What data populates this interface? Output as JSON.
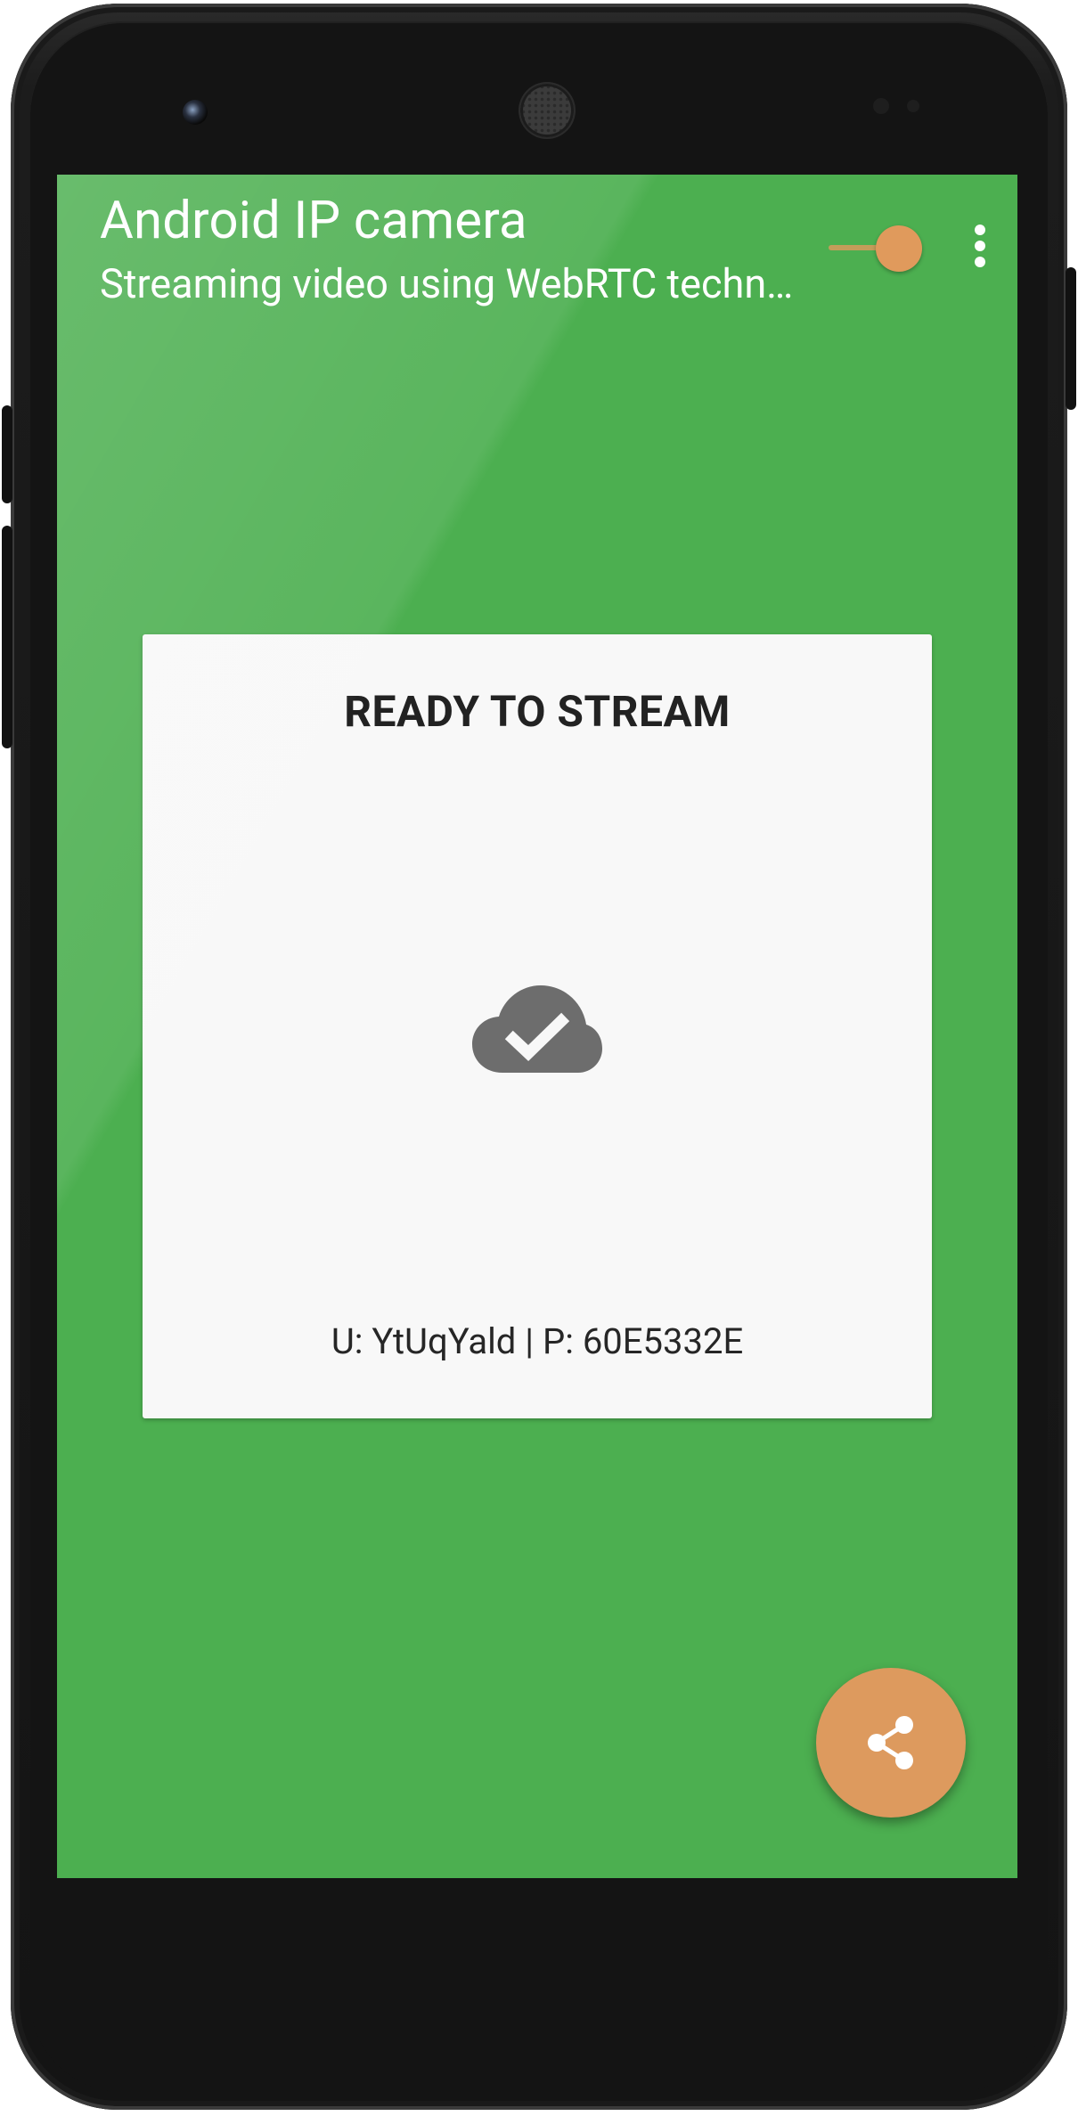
{
  "toolbar": {
    "title": "Android IP camera",
    "subtitle": "Streaming video using WebRTC technology",
    "stream_toggle": {
      "state": "on",
      "color": "#e09a5c"
    },
    "overflow_icon": "more-vert-icon"
  },
  "status_card": {
    "title": "READY TO STREAM",
    "icon": "cloud-done-icon",
    "credentials": "U: YtUqYald | P: 60E5332E"
  },
  "fab": {
    "icon": "share-icon",
    "color": "#dd9a5e"
  },
  "theme": {
    "primary": "#4caf50",
    "accent": "#dd9a5e",
    "card_background": "#f8f8f8"
  }
}
